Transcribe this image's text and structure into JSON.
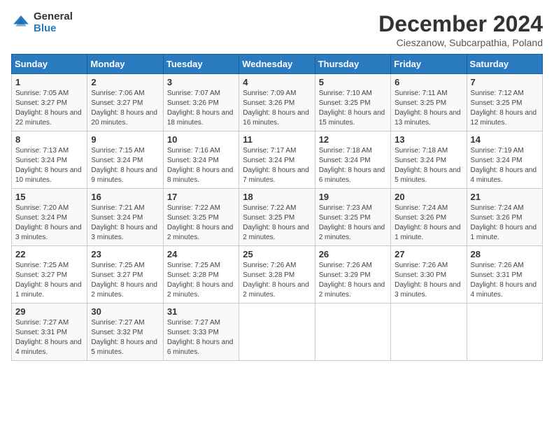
{
  "logo": {
    "general": "General",
    "blue": "Blue"
  },
  "title": "December 2024",
  "location": "Cieszanow, Subcarpathia, Poland",
  "headers": [
    "Sunday",
    "Monday",
    "Tuesday",
    "Wednesday",
    "Thursday",
    "Friday",
    "Saturday"
  ],
  "weeks": [
    [
      {
        "day": "1",
        "sunrise": "7:05 AM",
        "sunset": "3:27 PM",
        "daylight": "8 hours and 22 minutes."
      },
      {
        "day": "2",
        "sunrise": "7:06 AM",
        "sunset": "3:27 PM",
        "daylight": "8 hours and 20 minutes."
      },
      {
        "day": "3",
        "sunrise": "7:07 AM",
        "sunset": "3:26 PM",
        "daylight": "8 hours and 18 minutes."
      },
      {
        "day": "4",
        "sunrise": "7:09 AM",
        "sunset": "3:26 PM",
        "daylight": "8 hours and 16 minutes."
      },
      {
        "day": "5",
        "sunrise": "7:10 AM",
        "sunset": "3:25 PM",
        "daylight": "8 hours and 15 minutes."
      },
      {
        "day": "6",
        "sunrise": "7:11 AM",
        "sunset": "3:25 PM",
        "daylight": "8 hours and 13 minutes."
      },
      {
        "day": "7",
        "sunrise": "7:12 AM",
        "sunset": "3:25 PM",
        "daylight": "8 hours and 12 minutes."
      }
    ],
    [
      {
        "day": "8",
        "sunrise": "7:13 AM",
        "sunset": "3:24 PM",
        "daylight": "8 hours and 10 minutes."
      },
      {
        "day": "9",
        "sunrise": "7:15 AM",
        "sunset": "3:24 PM",
        "daylight": "8 hours and 9 minutes."
      },
      {
        "day": "10",
        "sunrise": "7:16 AM",
        "sunset": "3:24 PM",
        "daylight": "8 hours and 8 minutes."
      },
      {
        "day": "11",
        "sunrise": "7:17 AM",
        "sunset": "3:24 PM",
        "daylight": "8 hours and 7 minutes."
      },
      {
        "day": "12",
        "sunrise": "7:18 AM",
        "sunset": "3:24 PM",
        "daylight": "8 hours and 6 minutes."
      },
      {
        "day": "13",
        "sunrise": "7:18 AM",
        "sunset": "3:24 PM",
        "daylight": "8 hours and 5 minutes."
      },
      {
        "day": "14",
        "sunrise": "7:19 AM",
        "sunset": "3:24 PM",
        "daylight": "8 hours and 4 minutes."
      }
    ],
    [
      {
        "day": "15",
        "sunrise": "7:20 AM",
        "sunset": "3:24 PM",
        "daylight": "8 hours and 3 minutes."
      },
      {
        "day": "16",
        "sunrise": "7:21 AM",
        "sunset": "3:24 PM",
        "daylight": "8 hours and 3 minutes."
      },
      {
        "day": "17",
        "sunrise": "7:22 AM",
        "sunset": "3:25 PM",
        "daylight": "8 hours and 2 minutes."
      },
      {
        "day": "18",
        "sunrise": "7:22 AM",
        "sunset": "3:25 PM",
        "daylight": "8 hours and 2 minutes."
      },
      {
        "day": "19",
        "sunrise": "7:23 AM",
        "sunset": "3:25 PM",
        "daylight": "8 hours and 2 minutes."
      },
      {
        "day": "20",
        "sunrise": "7:24 AM",
        "sunset": "3:26 PM",
        "daylight": "8 hours and 1 minute."
      },
      {
        "day": "21",
        "sunrise": "7:24 AM",
        "sunset": "3:26 PM",
        "daylight": "8 hours and 1 minute."
      }
    ],
    [
      {
        "day": "22",
        "sunrise": "7:25 AM",
        "sunset": "3:27 PM",
        "daylight": "8 hours and 1 minute."
      },
      {
        "day": "23",
        "sunrise": "7:25 AM",
        "sunset": "3:27 PM",
        "daylight": "8 hours and 2 minutes."
      },
      {
        "day": "24",
        "sunrise": "7:25 AM",
        "sunset": "3:28 PM",
        "daylight": "8 hours and 2 minutes."
      },
      {
        "day": "25",
        "sunrise": "7:26 AM",
        "sunset": "3:28 PM",
        "daylight": "8 hours and 2 minutes."
      },
      {
        "day": "26",
        "sunrise": "7:26 AM",
        "sunset": "3:29 PM",
        "daylight": "8 hours and 2 minutes."
      },
      {
        "day": "27",
        "sunrise": "7:26 AM",
        "sunset": "3:30 PM",
        "daylight": "8 hours and 3 minutes."
      },
      {
        "day": "28",
        "sunrise": "7:26 AM",
        "sunset": "3:31 PM",
        "daylight": "8 hours and 4 minutes."
      }
    ],
    [
      {
        "day": "29",
        "sunrise": "7:27 AM",
        "sunset": "3:31 PM",
        "daylight": "8 hours and 4 minutes."
      },
      {
        "day": "30",
        "sunrise": "7:27 AM",
        "sunset": "3:32 PM",
        "daylight": "8 hours and 5 minutes."
      },
      {
        "day": "31",
        "sunrise": "7:27 AM",
        "sunset": "3:33 PM",
        "daylight": "8 hours and 6 minutes."
      },
      null,
      null,
      null,
      null
    ]
  ],
  "labels": {
    "sunrise": "Sunrise:",
    "sunset": "Sunset:",
    "daylight": "Daylight:"
  }
}
